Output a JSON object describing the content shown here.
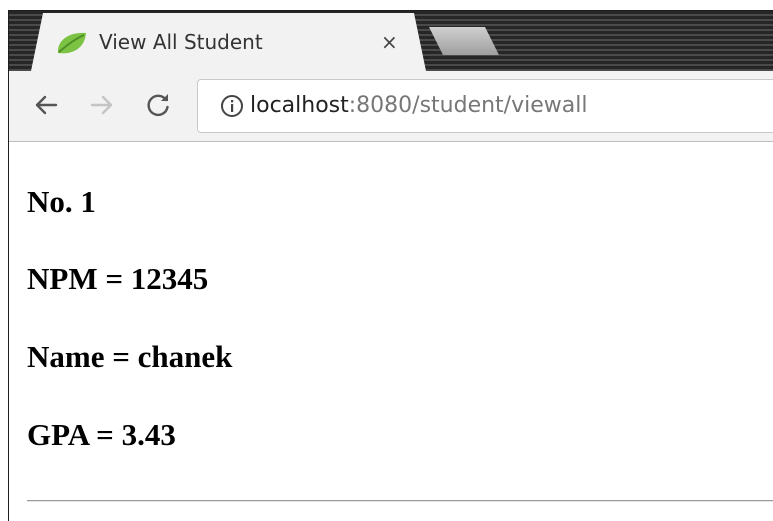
{
  "browser": {
    "tab": {
      "title": "View All Student",
      "close_glyph": "×",
      "favicon": "spring-leaf-icon"
    },
    "address": {
      "host": "localhost",
      "rest": ":8080/student/viewall"
    }
  },
  "page": {
    "number_label": "No. 1",
    "npm_label": "NPM = 12345",
    "name_label": "Name = chanek",
    "gpa_label": "GPA = 3.43"
  }
}
